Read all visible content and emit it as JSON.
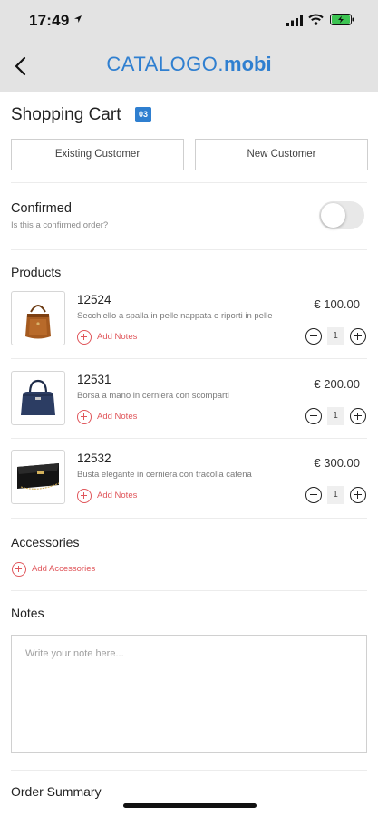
{
  "status_bar": {
    "time": "17:49"
  },
  "nav": {
    "logo_part1": "CATALOGO.",
    "logo_part2": "mobi"
  },
  "page": {
    "title": "Shopping Cart",
    "count_badge": "03"
  },
  "customer_buttons": {
    "existing": "Existing Customer",
    "new": "New Customer"
  },
  "confirmed": {
    "title": "Confirmed",
    "subtitle": "Is this a confirmed order?",
    "value": false
  },
  "products": {
    "heading": "Products",
    "items": [
      {
        "code": "12524",
        "description": "Secchiello a spalla in pelle nappata e riporti in pelle",
        "add_notes": "Add Notes",
        "price": "€ 100.00",
        "qty": "1",
        "image": "brown-leather-bucket-bag"
      },
      {
        "code": "12531",
        "description": "Borsa a mano in cerniera con scomparti",
        "add_notes": "Add Notes",
        "price": "€ 200.00",
        "qty": "1",
        "image": "navy-handbag"
      },
      {
        "code": "12532",
        "description": "Busta elegante in cerniera con tracolla catena",
        "add_notes": "Add Notes",
        "price": "€ 300.00",
        "qty": "1",
        "image": "black-clutch"
      }
    ]
  },
  "accessories": {
    "heading": "Accessories",
    "add_label": "Add Accessories"
  },
  "notes": {
    "heading": "Notes",
    "placeholder": "Write your note here..."
  },
  "order_summary": {
    "heading": "Order Summary"
  },
  "colors": {
    "accent": "#2f7fd0",
    "add_red": "#e0565b",
    "header_bg": "#e3e3e3"
  }
}
